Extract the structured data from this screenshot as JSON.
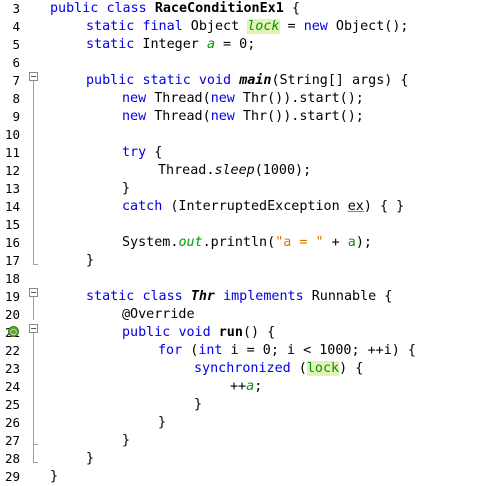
{
  "line_numbers": [
    "3",
    "4",
    "5",
    "6",
    "7",
    "8",
    "9",
    "10",
    "11",
    "12",
    "13",
    "14",
    "15",
    "16",
    "17",
    "18",
    "19",
    "20",
    "21",
    "22",
    "23",
    "24",
    "25",
    "26",
    "27",
    "28",
    "29"
  ],
  "tokens": {
    "public": "public",
    "class": "class",
    "static": "static",
    "final": "final",
    "new": "new",
    "void": "void",
    "try": "try",
    "catch": "catch",
    "implements": "implements",
    "for": "for",
    "int": "int",
    "synchronized": "synchronized",
    "class_name": "RaceConditionEx1",
    "open_brace": " {",
    "object_type": " Object ",
    "lock": "lock",
    "new_object": " Object();",
    "integer_type": " Integer ",
    "a": "a",
    "assign_zero": " = 0;",
    "main": "main",
    "main_params": "(String[] args) {",
    "thread": " Thread(",
    "thr_start": " Thr()).start();",
    "thread_prefix": "Thread.",
    "sleep": "sleep",
    "sleep_args": "(1000);",
    "close_brace": "}",
    "catch_args_pre": " (InterruptedException ",
    "ex": "ex",
    "catch_args_post": ") { }",
    "system_prefix": "System.",
    "out": "out",
    "println_pre": ".println(",
    "println_str": "\"a = \"",
    "println_plus": " + ",
    "println_post": ");",
    "thr": "Thr",
    "runnable": " Runnable {",
    "override": "@Override",
    "run": "run",
    "run_params": "() {",
    "for_paren": " (",
    "for_rest": " i = 0; i < 1000; ++i) {",
    "sync_open": " (",
    "sync_close": ") {",
    "increment": "++",
    "semicolon": ";",
    "equals": " = ",
    "space": " "
  },
  "colors": {
    "keyword": "#0000e6",
    "field": "#009900",
    "string": "#ce7b00",
    "highlight": "#e4f2b8",
    "override_badge": "#5ba42e"
  },
  "icons": {
    "fold": "fold-collapse-icon",
    "override": "override-indicator-icon"
  }
}
